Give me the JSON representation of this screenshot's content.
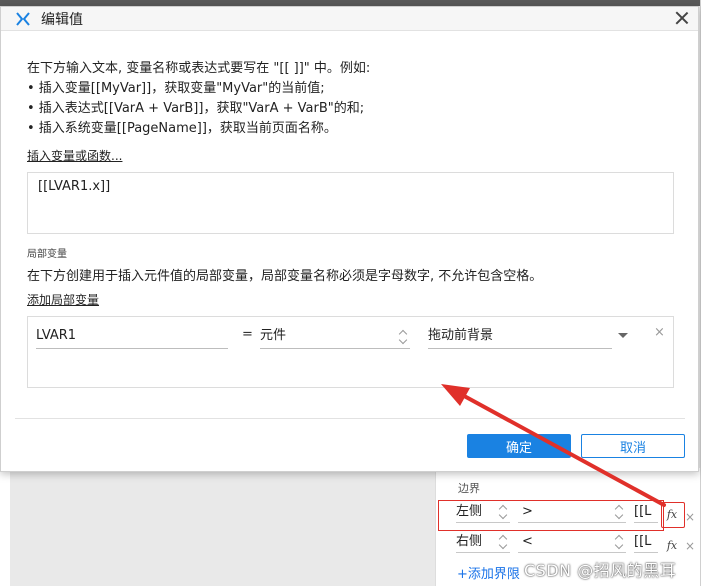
{
  "dialog": {
    "title": "编辑值",
    "instructions": [
      "在下方输入文本, 变量名称或表达式要写在 \"[[ ]]\" 中。例如:",
      "• 插入变量[[MyVar]]，获取变量\"MyVar\"的当前值;",
      "• 插入表达式[[VarA + VarB]]，获取\"VarA + VarB\"的和;",
      "• 插入系统变量[[PageName]]，获取当前页面名称。"
    ],
    "insert_var_link": "插入变量或函数...",
    "editor_value": "[[LVAR1.x]]",
    "local_section_title": "局部变量",
    "local_desc": "在下方创建用于插入元件值的局部变量，局部变量名称必须是字母数字, 不允许包含空格。",
    "add_local_link": "添加局部变量",
    "local_var": {
      "name": "LVAR1",
      "equals": "=",
      "type": "元件",
      "property": "拖动前背景",
      "remove": "×"
    },
    "ok_label": "确定",
    "cancel_label": "取消"
  },
  "background_panel": {
    "section_label": "边界",
    "rows": [
      {
        "side": "左侧",
        "operator": ">",
        "value": "[[L",
        "fx": "fx",
        "remove": "×"
      },
      {
        "side": "右侧",
        "operator": "<",
        "value": "[[L",
        "fx": "fx",
        "remove": "×"
      }
    ],
    "add_boundary": "+添加界限"
  },
  "watermark": "CSDN @招风的黑耳",
  "colors": {
    "primary": "#1a82e2",
    "annotation": "#e0302a"
  }
}
